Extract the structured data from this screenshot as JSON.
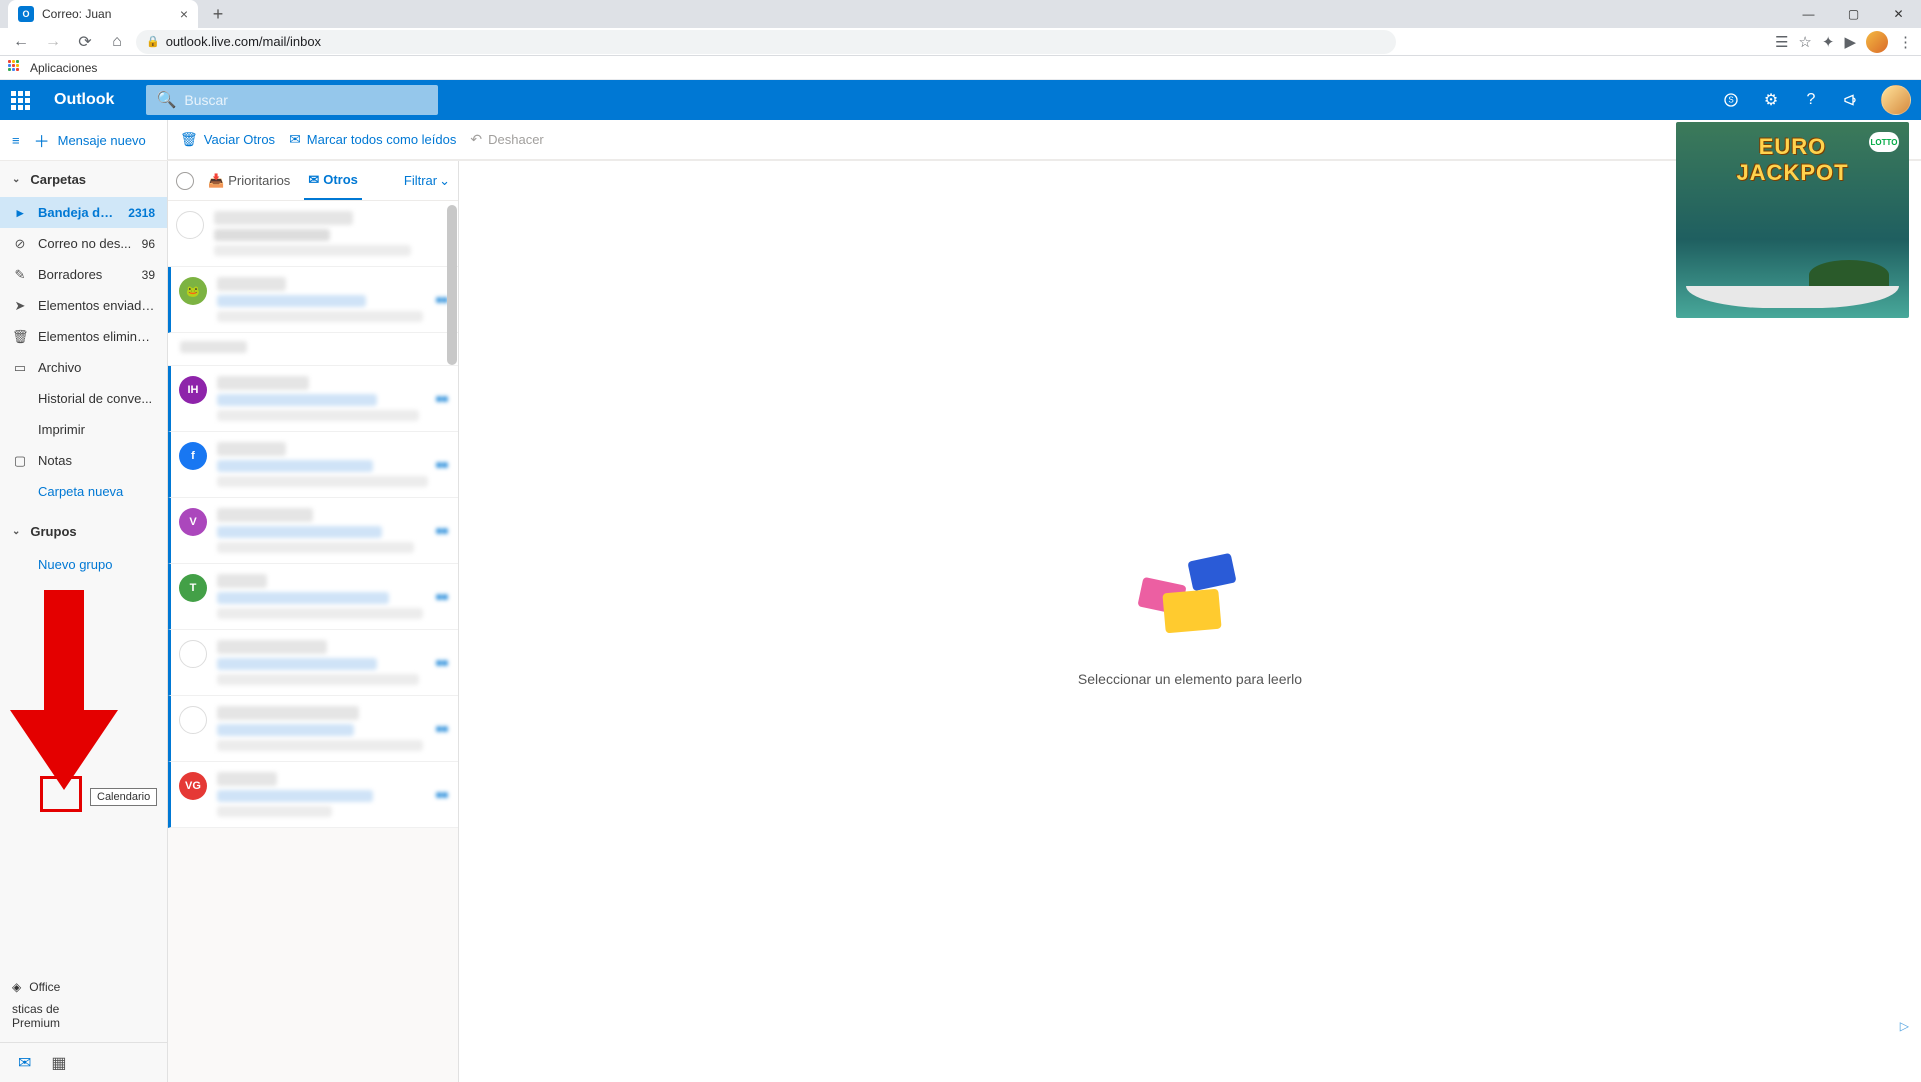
{
  "browser": {
    "tab_title": "Correo: Juan",
    "url": "outlook.live.com/mail/inbox",
    "bookmark_bar": "Aplicaciones"
  },
  "header": {
    "brand": "Outlook",
    "search_placeholder": "Buscar"
  },
  "toolbar": {
    "new_message": "Mensaje nuevo",
    "empty_others": "Vaciar Otros",
    "mark_all_read": "Marcar todos como leídos",
    "undo": "Deshacer"
  },
  "sidebar": {
    "folders_header": "Carpetas",
    "items": [
      {
        "label": "Bandeja de ...",
        "count": "2318",
        "icon": "inbox"
      },
      {
        "label": "Correo no des...",
        "count": "96",
        "icon": "clock"
      },
      {
        "label": "Borradores",
        "count": "39",
        "icon": "pencil"
      },
      {
        "label": "Elementos enviados",
        "count": "",
        "icon": "send"
      },
      {
        "label": "Elementos elimina...",
        "count": "",
        "icon": "trash"
      },
      {
        "label": "Archivo",
        "count": "",
        "icon": "archive"
      },
      {
        "label": "Historial de conve...",
        "count": "",
        "icon": ""
      },
      {
        "label": "Imprimir",
        "count": "",
        "icon": ""
      },
      {
        "label": "Notas",
        "count": "",
        "icon": "note"
      }
    ],
    "new_folder": "Carpeta nueva",
    "groups_header": "Grupos",
    "new_group": "Nuevo grupo",
    "upgrade_office": "Office",
    "premium_l1": "sticas de",
    "premium_l2": "Premium"
  },
  "msglist": {
    "tab_priority": "Prioritarios",
    "tab_others": "Otros",
    "filter": "Filtrar"
  },
  "reading": {
    "empty": "Seleccionar un elemento para leerlo"
  },
  "ad": {
    "line1": "EURO",
    "line2": "JACKPOT",
    "badge": "LOTTO"
  },
  "tooltip": "Calendario"
}
